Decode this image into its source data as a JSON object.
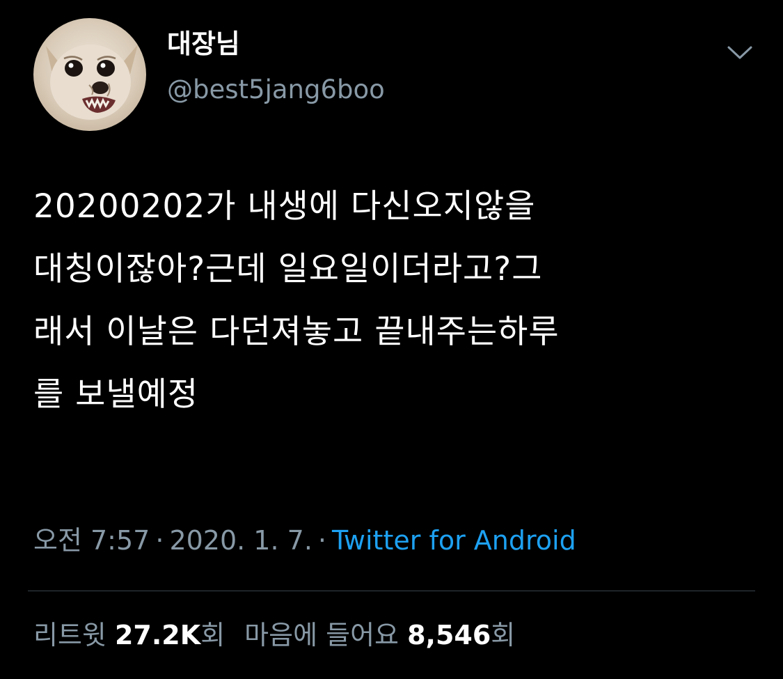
{
  "author": {
    "display_name": "대장님",
    "handle": "@best5jang6boo",
    "avatar_icon": "chihuahua-avatar"
  },
  "more_icon": "chevron-down-icon",
  "tweet": {
    "text": "20200202가 내생에 다신오지않을\n대칭이잖아?근데 일요일이더라고?그\n래서 이날은 다던져놓고 끝내주는하루\n를 보낼예정"
  },
  "meta": {
    "time": "오전 7:57",
    "separator": "·",
    "date": "2020. 1. 7.",
    "source": "Twitter for Android"
  },
  "stats": {
    "retweets_label": "리트윗",
    "retweets_count": "27.2K",
    "retweets_unit": "회",
    "likes_label": "마음에 들어요",
    "likes_count": "8,546",
    "likes_unit": "회"
  },
  "colors": {
    "background": "#000000",
    "text": "#ffffff",
    "secondary": "#8899a6",
    "link": "#1da1f2",
    "divider": "#38444d"
  }
}
